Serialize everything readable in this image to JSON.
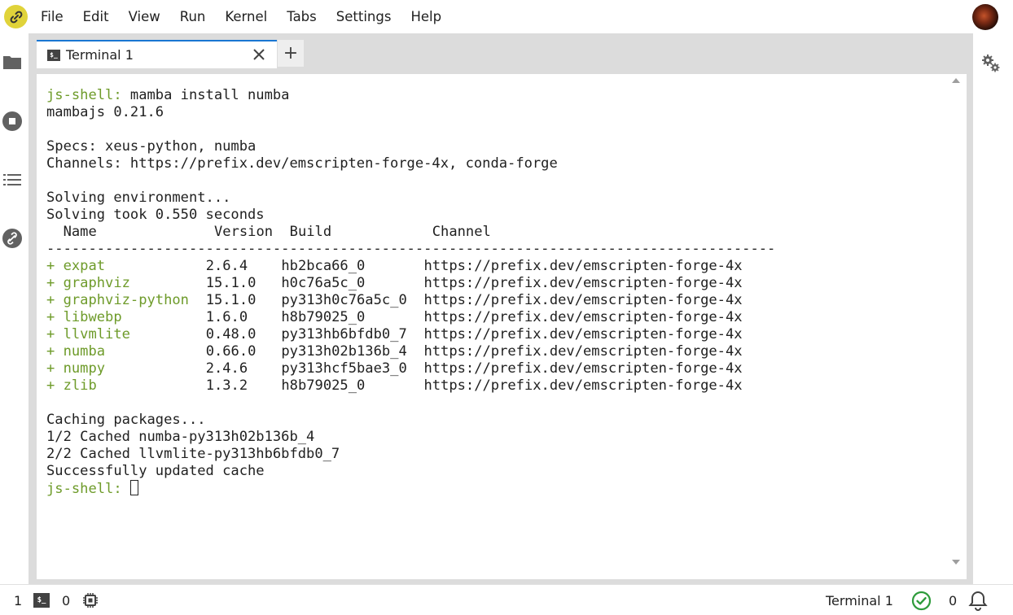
{
  "menubar": {
    "items": [
      "File",
      "Edit",
      "View",
      "Run",
      "Kernel",
      "Tabs",
      "Settings",
      "Help"
    ]
  },
  "tabs": [
    {
      "label": "Terminal 1",
      "icon": "terminal-icon",
      "active": true
    }
  ],
  "add_tab_label": "+",
  "terminal": {
    "lines": [
      {
        "prompt": "js-shell: ",
        "text": "mamba install numba"
      },
      {
        "text": "mambajs 0.21.6"
      },
      {
        "text": ""
      },
      {
        "text": "Specs: xeus-python, numba"
      },
      {
        "text": "Channels: https://prefix.dev/emscripten-forge-4x, conda-forge"
      },
      {
        "text": ""
      },
      {
        "text": "Solving environment..."
      },
      {
        "text": "Solving took 0.550 seconds"
      }
    ],
    "table": {
      "header": [
        "Name",
        "Version",
        "Build",
        "Channel"
      ],
      "separator": "---------------------------------------------------------------------------------------",
      "rows": [
        {
          "name": "+ expat",
          "version": "2.6.4",
          "build": "hb2bca66_0",
          "channel": "https://prefix.dev/emscripten-forge-4x"
        },
        {
          "name": "+ graphviz",
          "version": "15.1.0",
          "build": "h0c76a5c_0",
          "channel": "https://prefix.dev/emscripten-forge-4x"
        },
        {
          "name": "+ graphviz-python",
          "version": "15.1.0",
          "build": "py313h0c76a5c_0",
          "channel": "https://prefix.dev/emscripten-forge-4x"
        },
        {
          "name": "+ libwebp",
          "version": "1.6.0",
          "build": "h8b79025_0",
          "channel": "https://prefix.dev/emscripten-forge-4x"
        },
        {
          "name": "+ llvmlite",
          "version": "0.48.0",
          "build": "py313hb6bfdb0_7",
          "channel": "https://prefix.dev/emscripten-forge-4x"
        },
        {
          "name": "+ numba",
          "version": "0.66.0",
          "build": "py313h02b136b_4",
          "channel": "https://prefix.dev/emscripten-forge-4x"
        },
        {
          "name": "+ numpy",
          "version": "2.4.6",
          "build": "py313hcf5bae3_0",
          "channel": "https://prefix.dev/emscripten-forge-4x"
        },
        {
          "name": "+ zlib",
          "version": "1.3.2",
          "build": "h8b79025_0",
          "channel": "https://prefix.dev/emscripten-forge-4x"
        }
      ]
    },
    "tail_lines": [
      {
        "text": ""
      },
      {
        "text": "Caching packages..."
      },
      {
        "text": "1/2 Cached numba-py313h02b136b_4"
      },
      {
        "text": "2/2 Cached llvmlite-py313hb6bfdb0_7"
      },
      {
        "text": "Successfully updated cache"
      }
    ],
    "final_prompt": "js-shell: "
  },
  "statusbar": {
    "terminals_count": "1",
    "kernels_count": "0",
    "active_label": "Terminal 1",
    "notifications_count": "0"
  },
  "colors": {
    "prompt_green": "#6e9b2a",
    "tab_accent": "#1976d2",
    "logo_yellow": "#e0d33a"
  }
}
